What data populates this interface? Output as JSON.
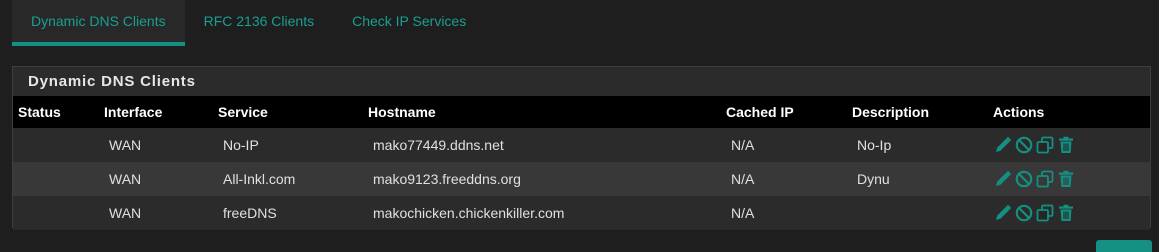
{
  "tabs": [
    {
      "label": "Dynamic DNS Clients",
      "active": true
    },
    {
      "label": "RFC 2136 Clients",
      "active": false
    },
    {
      "label": "Check IP Services",
      "active": false
    }
  ],
  "panel": {
    "title": "Dynamic DNS Clients"
  },
  "table": {
    "headers": {
      "status": "Status",
      "interface": "Interface",
      "service": "Service",
      "hostname": "Hostname",
      "cached_ip": "Cached IP",
      "description": "Description",
      "actions": "Actions"
    },
    "rows": [
      {
        "status": "",
        "interface": "WAN",
        "service": "No-IP",
        "hostname": "mako77449.ddns.net",
        "cached_ip": "N/A",
        "description": "No-Ip"
      },
      {
        "status": "",
        "interface": "WAN",
        "service": "All-Inkl.com",
        "hostname": "mako9123.freeddns.org",
        "cached_ip": "N/A",
        "description": "Dynu"
      },
      {
        "status": "",
        "interface": "WAN",
        "service": "freeDNS",
        "hostname": "makochicken.chickenkiller.com",
        "cached_ip": "N/A",
        "description": ""
      }
    ]
  },
  "icons": {
    "edit": "pencil-icon",
    "disable": "ban-icon",
    "copy": "clone-icon",
    "delete": "trash-icon"
  },
  "colors": {
    "accent": "#139082",
    "tab_text": "#1a9f91",
    "background": "#1e1e1e",
    "header_row": "#000000"
  }
}
